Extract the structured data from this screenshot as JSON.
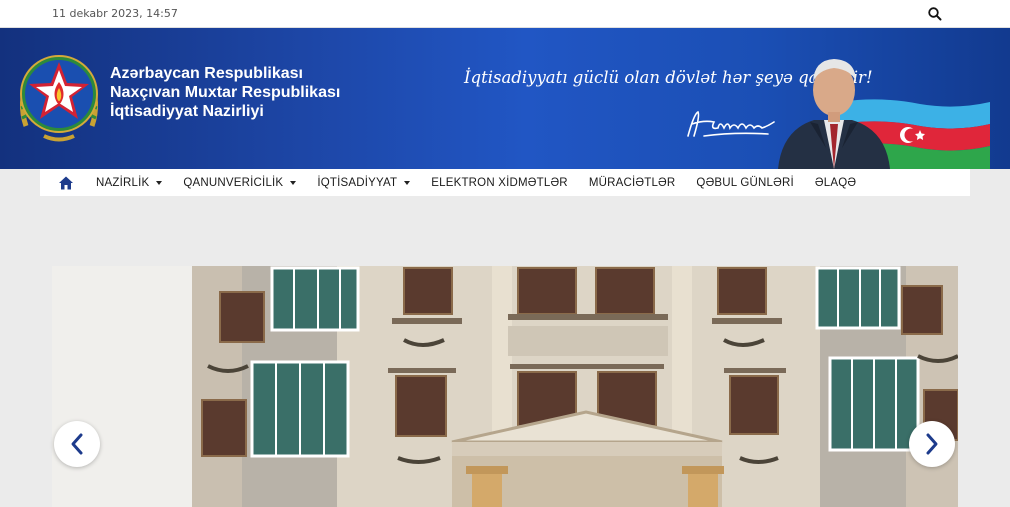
{
  "topbar": {
    "date": "11 dekabr 2023, 14:57",
    "search_icon": "search-icon"
  },
  "header": {
    "title_line1": "Azərbaycan  Respublikası",
    "title_line2": "Naxçıvan Muxtar Respublikası",
    "title_line3": "İqtisadiyyat Nazirliyi",
    "motto": "İqtisadiyyatı güclü olan dövlət hər şeyə qadirdir!",
    "emblem_icon": "state-emblem-icon",
    "colors": {
      "banner": "#1d46a6",
      "flag_blue": "#3cb1e6",
      "flag_red": "#e0263a",
      "flag_green": "#2ea64b"
    }
  },
  "nav": {
    "home_icon": "home-icon",
    "items": [
      {
        "label": "NAZİRLİK",
        "dropdown": true
      },
      {
        "label": "QANUNVERİCİLİK",
        "dropdown": true
      },
      {
        "label": "İQTİSADİYYAT",
        "dropdown": true
      },
      {
        "label": "ELEKTRON XİDMƏTLƏR",
        "dropdown": false
      },
      {
        "label": "MÜRACİƏTLƏR",
        "dropdown": false
      },
      {
        "label": "QƏBUL GÜNLƏRİ",
        "dropdown": false
      },
      {
        "label": "ƏLAQƏ",
        "dropdown": false
      }
    ]
  },
  "slider": {
    "prev_icon": "chevron-left-icon",
    "next_icon": "chevron-right-icon"
  }
}
